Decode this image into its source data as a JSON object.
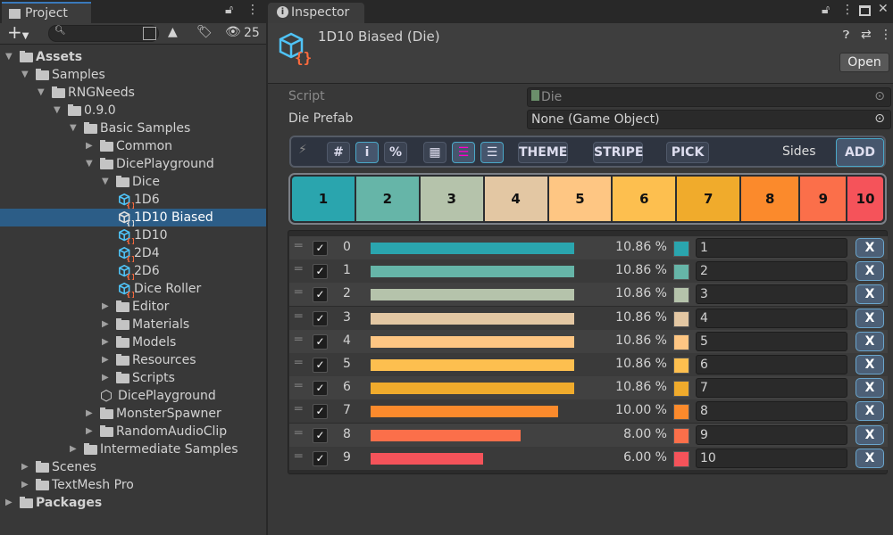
{
  "project": {
    "tab": "Project",
    "hidden_count": "25",
    "search_placeholder": "",
    "tree": [
      {
        "label": "Assets",
        "depth": 0,
        "type": "folder",
        "open": true,
        "bold": true
      },
      {
        "label": "Samples",
        "depth": 1,
        "type": "folder",
        "open": true
      },
      {
        "label": "RNGNeeds",
        "depth": 2,
        "type": "folder",
        "open": true
      },
      {
        "label": "0.9.0",
        "depth": 3,
        "type": "folder",
        "open": true
      },
      {
        "label": "Basic Samples",
        "depth": 4,
        "type": "folder",
        "open": true
      },
      {
        "label": "Common",
        "depth": 5,
        "type": "folder",
        "open": false
      },
      {
        "label": "DicePlayground",
        "depth": 5,
        "type": "folder",
        "open": true
      },
      {
        "label": "Dice",
        "depth": 6,
        "type": "folder",
        "open": true
      },
      {
        "label": "1D6",
        "depth": 7,
        "type": "asset"
      },
      {
        "label": "1D10 Biased",
        "depth": 7,
        "type": "asset",
        "selected": true
      },
      {
        "label": "1D10",
        "depth": 7,
        "type": "asset"
      },
      {
        "label": "2D4",
        "depth": 7,
        "type": "asset"
      },
      {
        "label": "2D6",
        "depth": 7,
        "type": "asset"
      },
      {
        "label": "Dice Roller",
        "depth": 7,
        "type": "asset"
      },
      {
        "label": "Editor",
        "depth": 6,
        "type": "folder",
        "open": false
      },
      {
        "label": "Materials",
        "depth": 6,
        "type": "folder",
        "open": false
      },
      {
        "label": "Models",
        "depth": 6,
        "type": "folder",
        "open": false
      },
      {
        "label": "Resources",
        "depth": 6,
        "type": "folder",
        "open": false
      },
      {
        "label": "Scripts",
        "depth": 6,
        "type": "folder",
        "open": false
      },
      {
        "label": "DicePlayground",
        "depth": 6,
        "type": "unity"
      },
      {
        "label": "MonsterSpawner",
        "depth": 5,
        "type": "folder",
        "open": false
      },
      {
        "label": "RandomAudioClip",
        "depth": 5,
        "type": "folder",
        "open": false
      },
      {
        "label": "Intermediate Samples",
        "depth": 4,
        "type": "folder",
        "open": false
      },
      {
        "label": "Scenes",
        "depth": 1,
        "type": "folder",
        "open": false
      },
      {
        "label": "TextMesh Pro",
        "depth": 1,
        "type": "folder",
        "open": false
      },
      {
        "label": "Packages",
        "depth": 0,
        "type": "folder",
        "open": false,
        "bold": true
      }
    ]
  },
  "inspector": {
    "tab": "Inspector",
    "title": "1D10 Biased (Die)",
    "open_button": "Open",
    "script_label": "Script",
    "script_value": "Die",
    "prefab_label": "Die Prefab",
    "prefab_value": "None (Game Object)",
    "toolbar": {
      "hash": "#",
      "info": "i",
      "percent": "%",
      "theme": "THEME",
      "stripe": "STRIPE",
      "pick": "PICK",
      "sides": "Sides",
      "add": "ADD"
    },
    "options": [
      {
        "index": "0",
        "percent": 10.86,
        "percent_label": "10.86 %",
        "color": "#2aa5ae",
        "value": "1",
        "enabled": true
      },
      {
        "index": "1",
        "percent": 10.86,
        "percent_label": "10.86 %",
        "color": "#66b5a8",
        "value": "2",
        "enabled": true
      },
      {
        "index": "2",
        "percent": 10.86,
        "percent_label": "10.86 %",
        "color": "#b5c3ab",
        "value": "3",
        "enabled": true
      },
      {
        "index": "3",
        "percent": 10.86,
        "percent_label": "10.86 %",
        "color": "#e3c7a3",
        "value": "4",
        "enabled": true
      },
      {
        "index": "4",
        "percent": 10.86,
        "percent_label": "10.86 %",
        "color": "#fec683",
        "value": "5",
        "enabled": true
      },
      {
        "index": "5",
        "percent": 10.86,
        "percent_label": "10.86 %",
        "color": "#fdbf4f",
        "value": "6",
        "enabled": true
      },
      {
        "index": "6",
        "percent": 10.86,
        "percent_label": "10.86 %",
        "color": "#f0ab2c",
        "value": "7",
        "enabled": true
      },
      {
        "index": "7",
        "percent": 10.0,
        "percent_label": "10.00 %",
        "color": "#fb8a2c",
        "value": "8",
        "enabled": true
      },
      {
        "index": "8",
        "percent": 8.0,
        "percent_label": "8.00 %",
        "color": "#fb6f4a",
        "value": "9",
        "enabled": true
      },
      {
        "index": "9",
        "percent": 6.0,
        "percent_label": "6.00 %",
        "color": "#f5535a",
        "value": "10",
        "enabled": true
      }
    ],
    "remove_label": "X"
  }
}
